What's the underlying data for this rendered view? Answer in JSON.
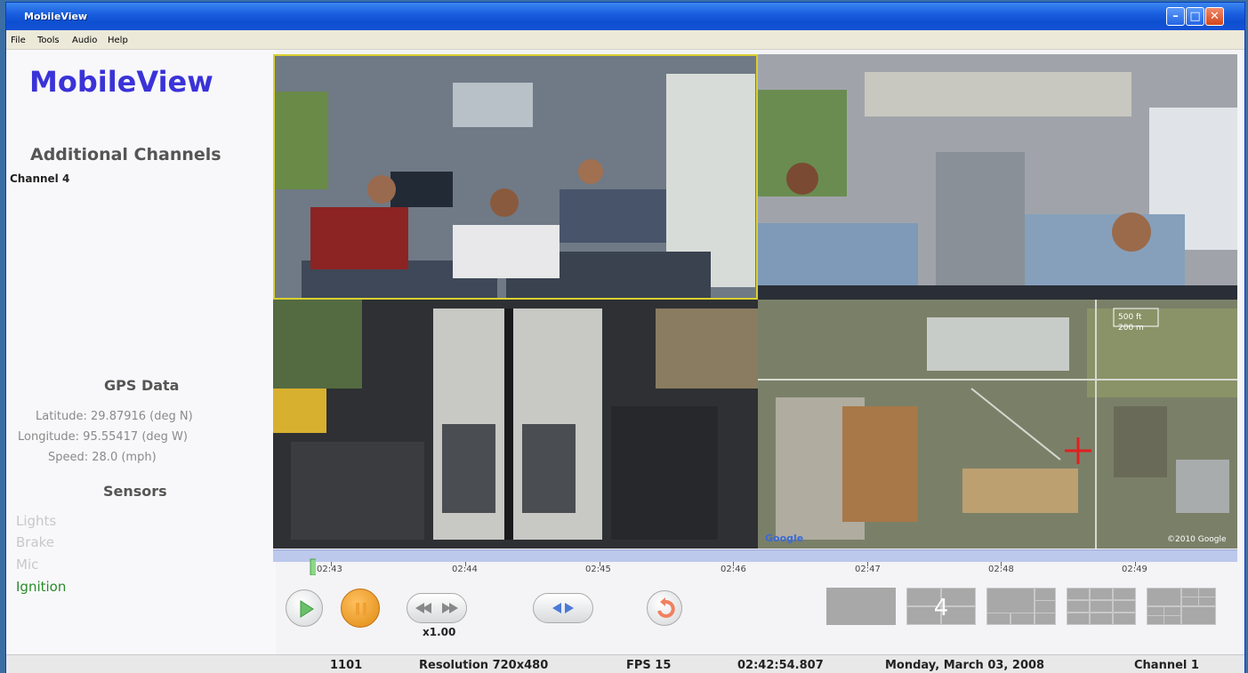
{
  "window": {
    "title": "MobileView"
  },
  "menu": [
    "File",
    "Tools",
    "Audio",
    "Help"
  ],
  "sidebar": {
    "app_name": "MobileView",
    "additional_channels": "Additional Channels",
    "channel": "Channel 4",
    "gps_heading": "GPS Data",
    "gps": {
      "latitude": "Latitude: 29.87916 (deg N)",
      "longitude": "Longitude: 95.55417 (deg W)",
      "speed": "Speed: 28.0 (mph)"
    },
    "sensors_heading": "Sensors",
    "sensors": [
      {
        "label": "Lights",
        "active": false
      },
      {
        "label": "Brake",
        "active": false
      },
      {
        "label": "Mic",
        "active": false
      },
      {
        "label": "Ignition",
        "active": true
      }
    ]
  },
  "video": {
    "map_labels": [
      "500 ft",
      "200 m",
      "Google",
      "©2010 Google"
    ]
  },
  "timeline": {
    "labels": [
      "02:43",
      "02:44",
      "02:45",
      "02:46",
      "02:47",
      "02:48",
      "02:49"
    ]
  },
  "playback": {
    "speed": "x1.00"
  },
  "layouts": [
    {
      "name": "single",
      "label": ""
    },
    {
      "name": "quad-4",
      "label": "4"
    },
    {
      "name": "grid-6",
      "label": ""
    },
    {
      "name": "grid-9",
      "label": ""
    },
    {
      "name": "grid-mix",
      "label": ""
    }
  ],
  "status": {
    "id": "1101",
    "resolution": "Resolution 720x480",
    "fps": "FPS 15",
    "time": "02:42:54.807",
    "date": "Monday, March 03, 2008",
    "channel": "Channel 1"
  },
  "colors": {
    "title_blue": "#3a33d8",
    "sensor_active": "#2a8a2a",
    "sensor_inactive": "#c8c8c8",
    "timeline": "#bcc8ec"
  }
}
